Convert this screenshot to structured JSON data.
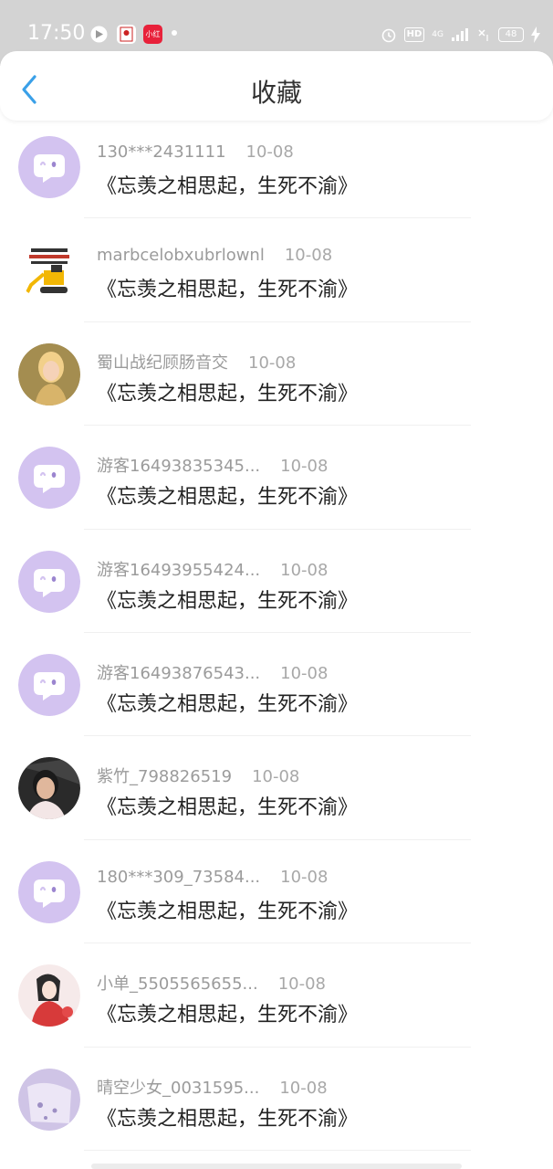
{
  "status_bar": {
    "time": "17:50",
    "network": "4G",
    "hd": "HD",
    "battery": "48",
    "app_icon_red_label": "小红书"
  },
  "header": {
    "title": "收藏",
    "back_icon": "chevron-left-icon"
  },
  "favorites": [
    {
      "user": "130***2431111",
      "date": "10-08",
      "title": "《忘羡之相思起，生死不渝》",
      "avatar": "chat-bubble"
    },
    {
      "user": "marbcelobxubrlownl",
      "date": "10-08",
      "title": "《忘羡之相思起，生死不渝》",
      "avatar": "excavator-photo"
    },
    {
      "user": "蜀山战纪顾肠音交",
      "date": "10-08",
      "title": "《忘羡之相思起，生死不渝》",
      "avatar": "woman-photo"
    },
    {
      "user": "游客16493835345...",
      "date": "10-08",
      "title": "《忘羡之相思起，生死不渝》",
      "avatar": "chat-bubble"
    },
    {
      "user": "游客16493955424...",
      "date": "10-08",
      "title": "《忘羡之相思起，生死不渝》",
      "avatar": "chat-bubble"
    },
    {
      "user": "游客16493876543...",
      "date": "10-08",
      "title": "《忘羡之相思起，生死不渝》",
      "avatar": "chat-bubble"
    },
    {
      "user": "紫竹_798826519",
      "date": "10-08",
      "title": "《忘羡之相思起，生死不渝》",
      "avatar": "person-photo"
    },
    {
      "user": "180***309_73584...",
      "date": "10-08",
      "title": "《忘羡之相思起，生死不渝》",
      "avatar": "chat-bubble"
    },
    {
      "user": "小单_5505565655...",
      "date": "10-08",
      "title": "《忘羡之相思起，生死不渝》",
      "avatar": "illustration"
    },
    {
      "user": "晴空少女_0031595...",
      "date": "10-08",
      "title": "《忘羡之相思起，生死不渝》",
      "avatar": "lavender-photo"
    }
  ],
  "colors": {
    "accent": "#3aa0e8",
    "avatar_purple": "#d3c3f0",
    "status_bar": "#d3d3d3"
  }
}
